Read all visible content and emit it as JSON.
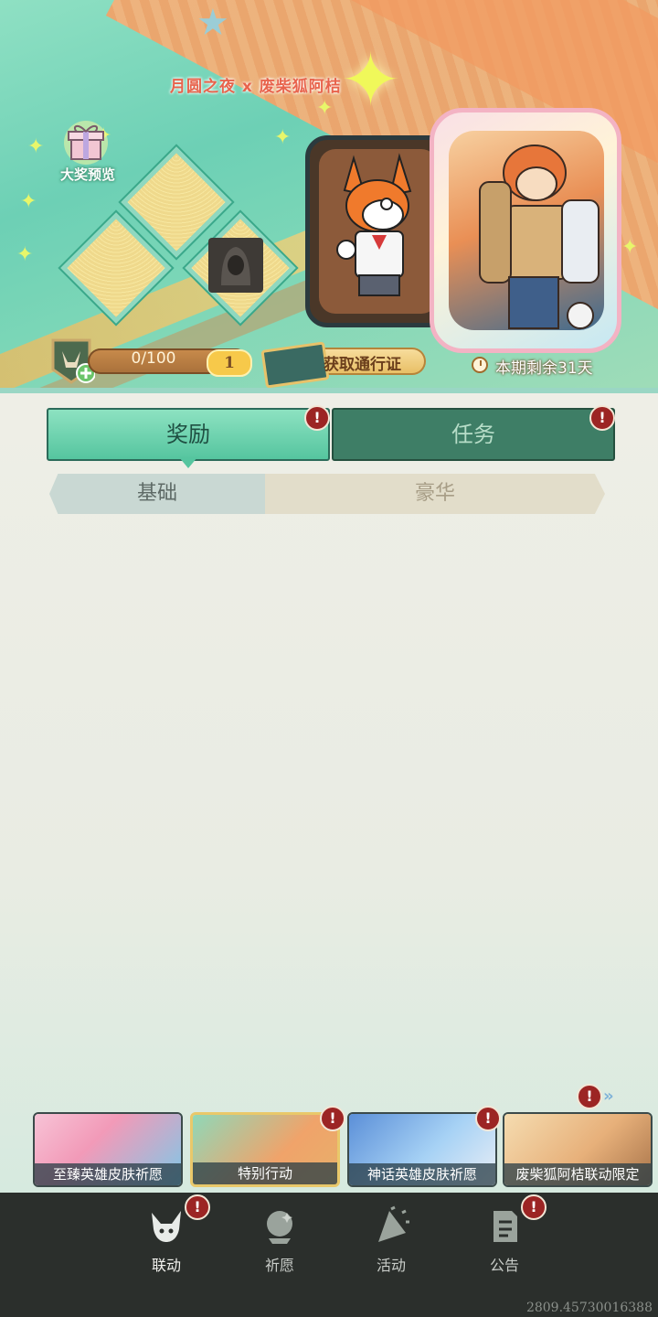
{
  "banner": {
    "collab_title": "月圆之夜 x 废柴狐阿桔",
    "grand_prize_label": "大奖预览",
    "progress": "0/100",
    "progress_fraction": 0.0,
    "level": "1",
    "get_pass_label": "获取通行证",
    "remaining": "本期剩余31天"
  },
  "tabs": {
    "rewards": "奖励",
    "tasks": "任务",
    "rewards_badge": "!",
    "tasks_badge": "!"
  },
  "subtabs": {
    "basic": "基础",
    "deluxe": "豪华"
  },
  "events": [
    {
      "label": "至臻英雄皮肤祈愿"
    },
    {
      "label": "特别行动",
      "badge": "!"
    },
    {
      "label": "神话英雄皮肤祈愿",
      "badge": "!"
    },
    {
      "label": "废柴狐阿桔联动限定"
    }
  ],
  "events_badge": "!",
  "nav": {
    "link": "联动",
    "wish": "祈愿",
    "activity": "活动",
    "notice": "公告",
    "link_badge": "!",
    "notice_badge": "!"
  },
  "version": "2809.45730016388",
  "colors": {
    "accent_green": "#55c59f",
    "tab_dark_green": "#3e7e66",
    "badge_red": "#9c2524",
    "nav_bg": "#2b2f2c"
  }
}
